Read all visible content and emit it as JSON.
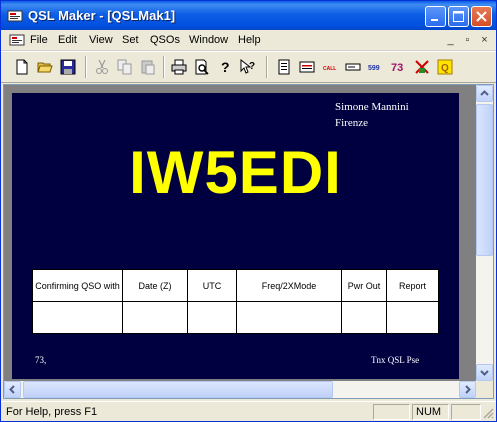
{
  "window": {
    "title": "QSL Maker - [QSLMak1]"
  },
  "menu": [
    "File",
    "Edit",
    "View",
    "Set",
    "QSOs",
    "Window",
    "Help"
  ],
  "mdi_controls": [
    "_",
    "▫",
    "×"
  ],
  "toolbar": {
    "icons": [
      "new-icon",
      "open-icon",
      "save-icon",
      "cut-icon",
      "copy-icon",
      "paste-icon",
      "print-icon",
      "print-preview-icon",
      "about-icon",
      "context-help-icon",
      "page-icon",
      "card-icon",
      "call-icon",
      "field-icon",
      "599-icon",
      "73-icon",
      "grid-icon",
      "qso-icon"
    ],
    "labels": {
      "call": "CALL",
      "rst": "599",
      "seventy_three": "73",
      "q": "Q"
    }
  },
  "card": {
    "name": "Simone Mannini",
    "city": "Firenze",
    "callsign": "IW5EDI",
    "table_headers": [
      "Confirming QSO with",
      "Date (Z)",
      "UTC",
      "Freq/2XMode",
      "Pwr Out",
      "Report"
    ],
    "footer_left": "73,",
    "footer_right": "Tnx  QSL  Pse",
    "colors": {
      "background": "#000040",
      "callsign": "#ffff00",
      "text": "#ffffff"
    }
  },
  "status": {
    "text": "For Help, press F1",
    "indicator": "NUM"
  }
}
